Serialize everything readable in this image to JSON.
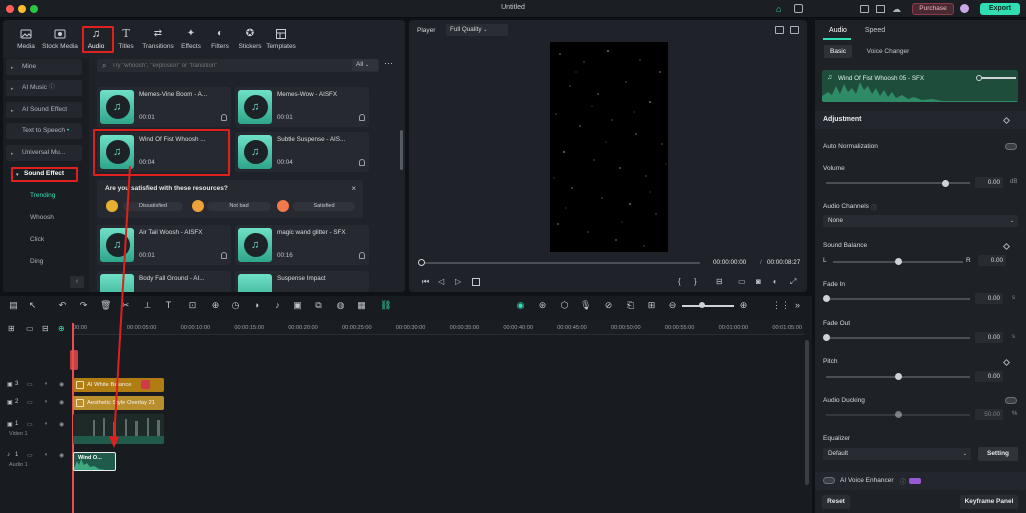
{
  "window": {
    "title": "Untitled",
    "purchase_label": "Purchase",
    "export_label": "Export"
  },
  "media_tabs": [
    "Media",
    "Stock Media",
    "Audio",
    "Titles",
    "Transitions",
    "Effects",
    "Filters",
    "Stickers",
    "Templates"
  ],
  "sidebar": {
    "items": [
      "Mine",
      "AI Music",
      "AI Sound Effect",
      "Text to Speech",
      "Universal Mu...",
      "Sound Effect"
    ],
    "sub_items": [
      "Trending",
      "Whoosh",
      "Click",
      "Ding"
    ]
  },
  "search": {
    "placeholder": "Try \"whoosh\", \"explosion\" or \"transition\"",
    "filter": "All"
  },
  "audio_cards": [
    {
      "name": "Memes-Vine Boom - A...",
      "duration": "00:01"
    },
    {
      "name": "Memes-Wow - AISFX",
      "duration": "00:01"
    },
    {
      "name": "Wind Of Fist Whoosh ...",
      "duration": "00:04"
    },
    {
      "name": "Subtle Suspense - AIS...",
      "duration": "00:04"
    },
    {
      "name": "Air Tail Woosh - AISFX",
      "duration": "00:01"
    },
    {
      "name": "magic wand glitter - SFX",
      "duration": "00:16"
    },
    {
      "name": "Body Fall Ground - AI...",
      "duration": ""
    },
    {
      "name": "Suspense Impact",
      "duration": ""
    }
  ],
  "survey": {
    "question": "Are you satisfied with these resources?",
    "options": [
      "Dissatisfied",
      "Not bad",
      "Satisfied"
    ]
  },
  "player": {
    "label": "Player",
    "quality": "Full Quality",
    "current_time": "00:00:00:00",
    "separator": "/",
    "total_time": "00:00:08:27"
  },
  "props": {
    "tabs": [
      "Audio",
      "Speed"
    ],
    "subtabs": [
      "Basic",
      "Voice Changer"
    ],
    "clip_name": "Wind Of Fist Whoosh 05 - SFX",
    "adjustment": "Adjustment",
    "auto_normalization": "Auto Normalization",
    "volume": {
      "label": "Volume",
      "value": "0.00",
      "unit": "dB",
      "level": 0.83
    },
    "audio_channels": {
      "label": "Audio Channels",
      "value": "None"
    },
    "sound_balance": {
      "label": "Sound Balance",
      "left": "L",
      "right": "R",
      "value": "0.00",
      "level": 0.5
    },
    "fade_in": {
      "label": "Fade In",
      "value": "0.00",
      "unit": "s",
      "level": 0.0
    },
    "fade_out": {
      "label": "Fade Out",
      "value": "0.00",
      "unit": "s",
      "level": 0.0
    },
    "pitch": {
      "label": "Pitch",
      "value": "0.00",
      "level": 0.5
    },
    "audio_ducking": {
      "label": "Audio Ducking",
      "value": "50.00",
      "unit": "%",
      "level": 0.5
    },
    "equalizer": {
      "label": "Equalizer",
      "value": "Default",
      "setting": "Setting"
    },
    "ai_voice_enhancer": "AI Voice Enhancer",
    "reset": "Reset",
    "keyframe_panel": "Keyframe Panel"
  },
  "timeline": {
    "ruler": [
      "00:00",
      "00:00:05:00",
      "00:00:10:00",
      "00:00:15:00",
      "00:00:20:00",
      "00:00:25:00",
      "00:00:30:00",
      "00:00:35:00",
      "00:00:40:00",
      "00:00:45:00",
      "00:00:50:00",
      "00:00:55:00",
      "00:01:00:00",
      "00:01:05:00"
    ],
    "tracks": [
      {
        "num": "3",
        "clip": "AI White Balance"
      },
      {
        "num": "2",
        "clip": "Aesthetic Style Overlay 21"
      },
      {
        "num": "1",
        "sub": "Video 1"
      },
      {
        "num": "1",
        "sub": "Audio 1",
        "clip": "Wind O..."
      }
    ]
  },
  "colors": {
    "accent": "#2fdfb3",
    "highlight": "#e0201f",
    "text_clip": "#b8860b",
    "overlay_clip": "#c9a43a"
  }
}
